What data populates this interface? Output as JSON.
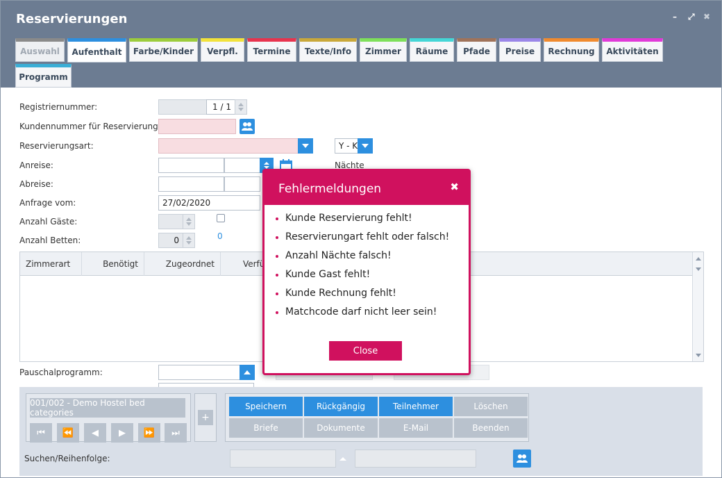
{
  "window": {
    "title": "Reservierungen",
    "controls": {
      "minimize": "–",
      "maximize": "⤢",
      "close": "✖"
    }
  },
  "tabs": [
    {
      "label": "Auswahl",
      "color": "#8a8a8a",
      "state": "disabled"
    },
    {
      "label": "Aufenthalt",
      "color": "#2d8fdf",
      "state": "active"
    },
    {
      "label": "Farbe/Kinder",
      "color": "#9ccc3c",
      "state": "normal"
    },
    {
      "label": "Verpfl.",
      "color": "#f2e23a",
      "state": "normal"
    },
    {
      "label": "Termine",
      "color": "#e8344e",
      "state": "normal"
    },
    {
      "label": "Texte/Info",
      "color": "#c9a83a",
      "state": "normal"
    },
    {
      "label": "Zimmer",
      "color": "#7ee05a",
      "state": "normal"
    },
    {
      "label": "Räume",
      "color": "#44d6d6",
      "state": "normal"
    },
    {
      "label": "Pfade",
      "color": "#a0735a",
      "state": "normal"
    },
    {
      "label": "Preise",
      "color": "#9a86e8",
      "state": "normal"
    },
    {
      "label": "Rechnung",
      "color": "#f08a2e",
      "state": "normal"
    },
    {
      "label": "Aktivitäten",
      "color": "#e03ad8",
      "state": "normal"
    },
    {
      "label": "Programm",
      "color": "#3aaed6",
      "state": "normal"
    }
  ],
  "form": {
    "registriernummer": {
      "label": "Registriernummer:",
      "counter": "1 / 1"
    },
    "kundennummer": {
      "label": "Kundennummer für Reservierung",
      "value": ""
    },
    "reservierungsart": {
      "label": "Reservierungsart:",
      "value": "",
      "side_value": "Y - K"
    },
    "anreise": {
      "label": "Anreise:",
      "value": "",
      "time": "",
      "side_label": "Nächte"
    },
    "abreise": {
      "label": "Abreise:",
      "value": "",
      "time": ""
    },
    "anfrage": {
      "label": "Anfrage vom:",
      "value": "27/02/2020"
    },
    "gaeste": {
      "label": "Anzahl Gäste:",
      "value": ""
    },
    "betten": {
      "label": "Anzahl Betten:",
      "value": "0",
      "side_value": "0"
    },
    "pauschal": {
      "label": "Pauschalprogramm:",
      "value": ""
    }
  },
  "grid": {
    "columns": [
      "Zimmerart",
      "Benötigt",
      "Zugeordnet",
      "Verfüg"
    ]
  },
  "bottom": {
    "record_name": "001/002 - Demo Hostel bed categories",
    "nav": [
      "⏮",
      "⏪",
      "◀",
      "▶",
      "⏩",
      "⏭"
    ],
    "plus": "+",
    "actions": [
      {
        "label": "Speichern",
        "style": "blue"
      },
      {
        "label": "Rückgängig",
        "style": "blue"
      },
      {
        "label": "Teilnehmer",
        "style": "blue"
      },
      {
        "label": "Löschen",
        "style": "gray"
      },
      {
        "label": "Briefe",
        "style": "gray"
      },
      {
        "label": "Dokumente",
        "style": "gray"
      },
      {
        "label": "E-Mail",
        "style": "gray"
      },
      {
        "label": "Beenden",
        "style": "gray"
      }
    ],
    "search_label": "Suchen/Reihenfolge:",
    "search_value": "",
    "search_value2": ""
  },
  "dialog": {
    "title": "Fehlermeldungen",
    "close_icon": "✖",
    "messages": [
      "Kunde Reservierung fehlt!",
      "Reservierungart fehlt oder falsch!",
      "Anzahl Nächte falsch!",
      "Kunde Gast fehlt!",
      "Kunde Rechnung fehlt!",
      "Matchcode darf nicht leer sein!"
    ],
    "button": "Close",
    "color": "#d0115e"
  }
}
